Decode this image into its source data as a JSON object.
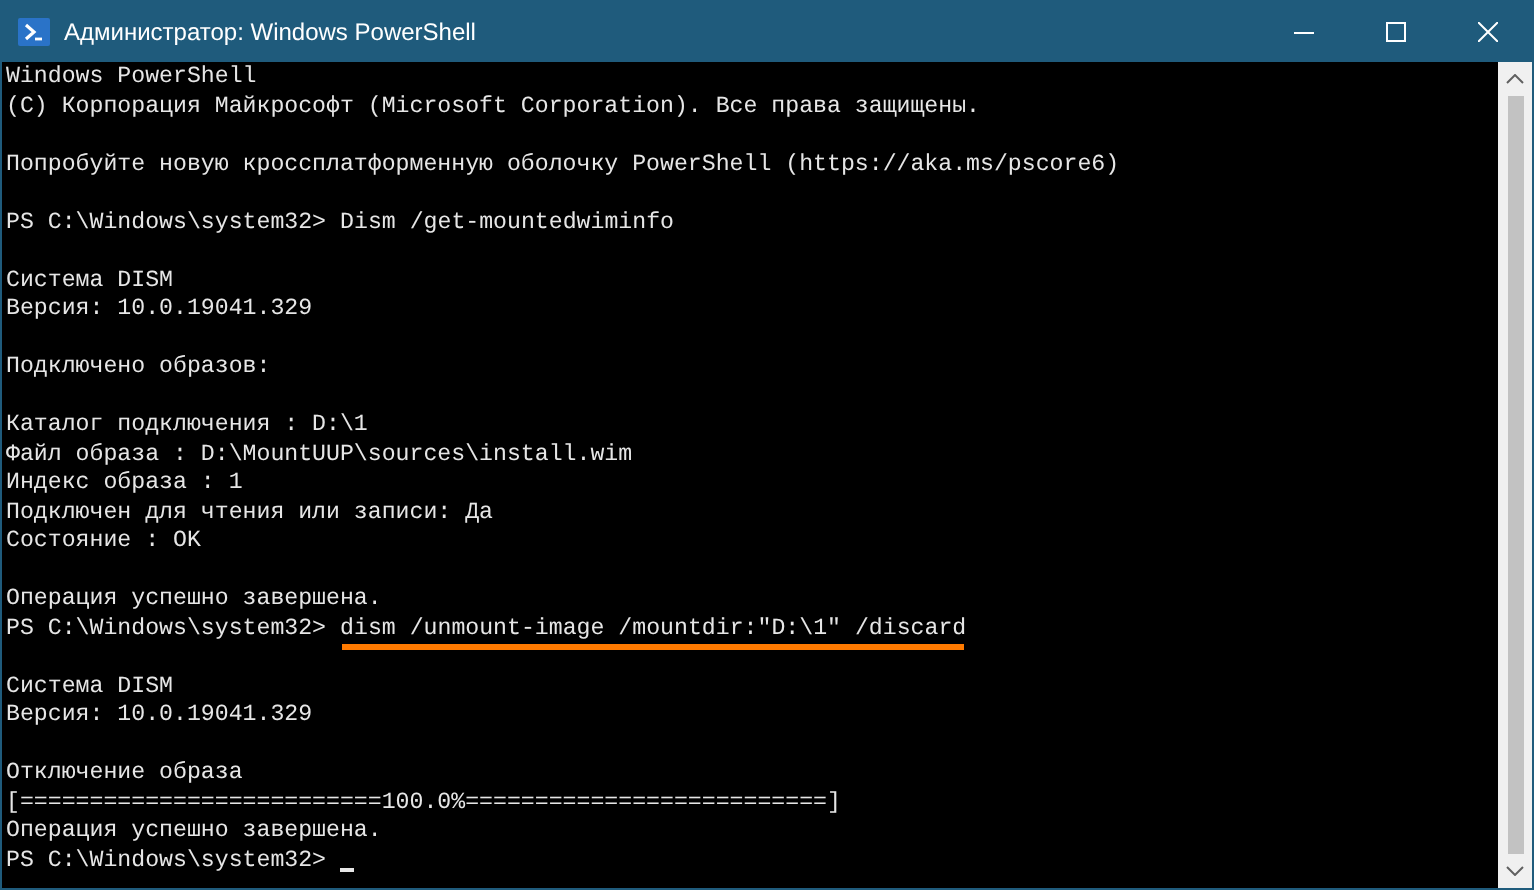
{
  "window": {
    "title": "Администратор: Windows PowerShell"
  },
  "console": {
    "lines": [
      {
        "kind": "output",
        "text": "Windows PowerShell"
      },
      {
        "kind": "output",
        "text": "(C) Корпорация Майкрософт (Microsoft Corporation). Все права защищены."
      },
      {
        "kind": "blank"
      },
      {
        "kind": "output",
        "text": "Попробуйте новую кроссплатформенную оболочку PowerShell (https://aka.ms/pscore6)"
      },
      {
        "kind": "blank"
      },
      {
        "kind": "prompt",
        "prompt": "PS C:\\Windows\\system32>",
        "command": "Dism /get-mountedwiminfo"
      },
      {
        "kind": "blank"
      },
      {
        "kind": "output",
        "text": "Система DISM"
      },
      {
        "kind": "output",
        "text": "Версия: 10.0.19041.329"
      },
      {
        "kind": "blank"
      },
      {
        "kind": "output",
        "text": "Подключено образов:"
      },
      {
        "kind": "blank"
      },
      {
        "kind": "output",
        "text": "Каталог подключения : D:\\1"
      },
      {
        "kind": "output",
        "text": "Файл образа : D:\\MountUUP\\sources\\install.wim"
      },
      {
        "kind": "output",
        "text": "Индекс образа : 1"
      },
      {
        "kind": "output",
        "text": "Подключен для чтения или записи: Да"
      },
      {
        "kind": "output",
        "text": "Состояние : OK"
      },
      {
        "kind": "blank"
      },
      {
        "kind": "output",
        "text": "Операция успешно завершена."
      },
      {
        "kind": "prompt",
        "prompt": "PS C:\\Windows\\system32>",
        "command": "dism /unmount-image /mountdir:\"D:\\1\" /discard",
        "underlined": true
      },
      {
        "kind": "blank"
      },
      {
        "kind": "output",
        "text": "Система DISM"
      },
      {
        "kind": "output",
        "text": "Версия: 10.0.19041.329"
      },
      {
        "kind": "blank"
      },
      {
        "kind": "output",
        "text": "Отключение образа"
      },
      {
        "kind": "output",
        "text": "[==========================100.0%==========================]"
      },
      {
        "kind": "output",
        "text": "Операция успешно завершена."
      },
      {
        "kind": "prompt",
        "prompt": "PS C:\\Windows\\system32>",
        "cursor": true
      }
    ]
  }
}
